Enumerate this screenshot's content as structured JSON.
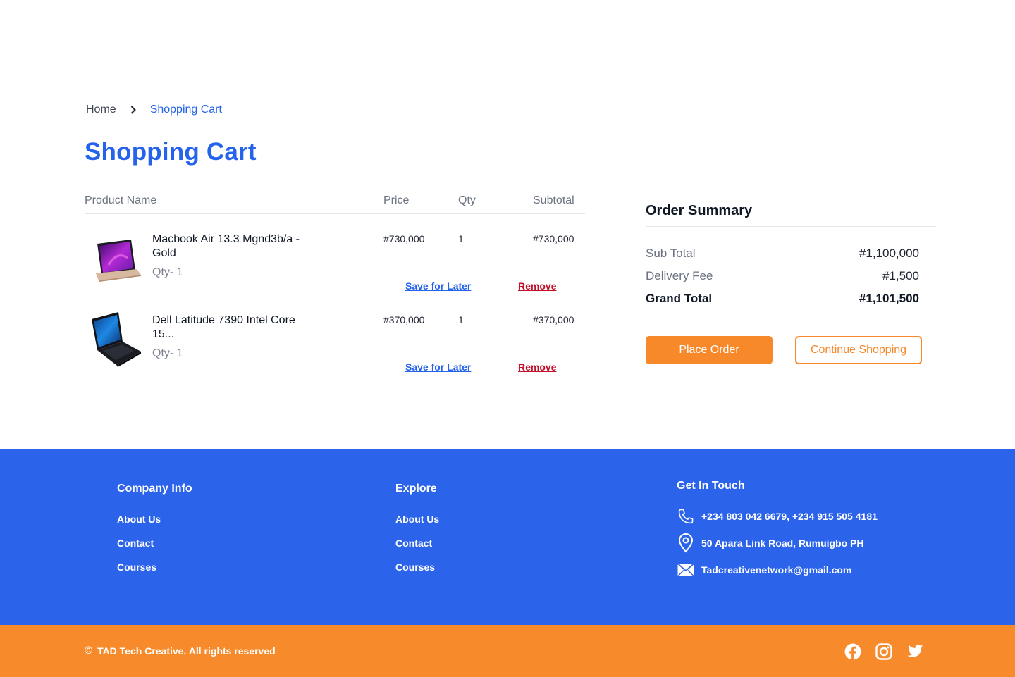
{
  "breadcrumb": {
    "home": "Home",
    "current": "Shopping Cart"
  },
  "page_title": "Shopping Cart",
  "cart": {
    "headers": {
      "product": "Product Name",
      "price": "Price",
      "qty": "Qty",
      "subtotal": "Subtotal"
    },
    "items": [
      {
        "name": "Macbook Air 13.3 Mgnd3b/a - Gold",
        "qty_label": "Qty- 1",
        "price": "#730,000",
        "qty": "1",
        "subtotal": "#730,000",
        "save_label": "Save for Later",
        "remove_label": "Remove"
      },
      {
        "name": "Dell Latitude 7390 Intel Core 15...",
        "qty_label": "Qty- 1",
        "price": "#370,000",
        "qty": "1",
        "subtotal": "#370,000",
        "save_label": "Save for Later",
        "remove_label": "Remove"
      }
    ]
  },
  "summary": {
    "title": "Order Summary",
    "sub_total_label": "Sub Total",
    "sub_total": "#1,100,000",
    "delivery_label": "Delivery Fee",
    "delivery": "#1,500",
    "grand_label": "Grand Total",
    "grand": "#1,101,500",
    "place_order": "Place Order",
    "continue_shopping": "Continue Shopping"
  },
  "footer": {
    "company": {
      "title": "Company Info",
      "links": [
        "About Us",
        "Contact",
        "Courses"
      ]
    },
    "explore": {
      "title": "Explore",
      "links": [
        "About Us",
        "Contact",
        "Courses"
      ]
    },
    "touch": {
      "title": "Get In Touch",
      "phone": "+234 803 042 6679, +234 915 505 4181",
      "address": "50 Apara Link Road, Rumuigbo PH",
      "email": "Tadcreativenetwork@gmail.com"
    },
    "copyright": "TAD Tech Creative. All rights reserved",
    "copyright_symbol": "©"
  },
  "icons": {
    "breadcrumb_separator": "chevron-right-icon",
    "phone": "phone-icon",
    "location": "location-pin-icon",
    "email": "mail-icon",
    "socials": [
      "facebook-icon",
      "instagram-icon",
      "twitter-icon"
    ]
  },
  "colors": {
    "primary_blue": "#2563eb",
    "footer_blue": "#2b63eb",
    "accent_orange": "#f7892b",
    "remove_red": "#c2102a"
  }
}
